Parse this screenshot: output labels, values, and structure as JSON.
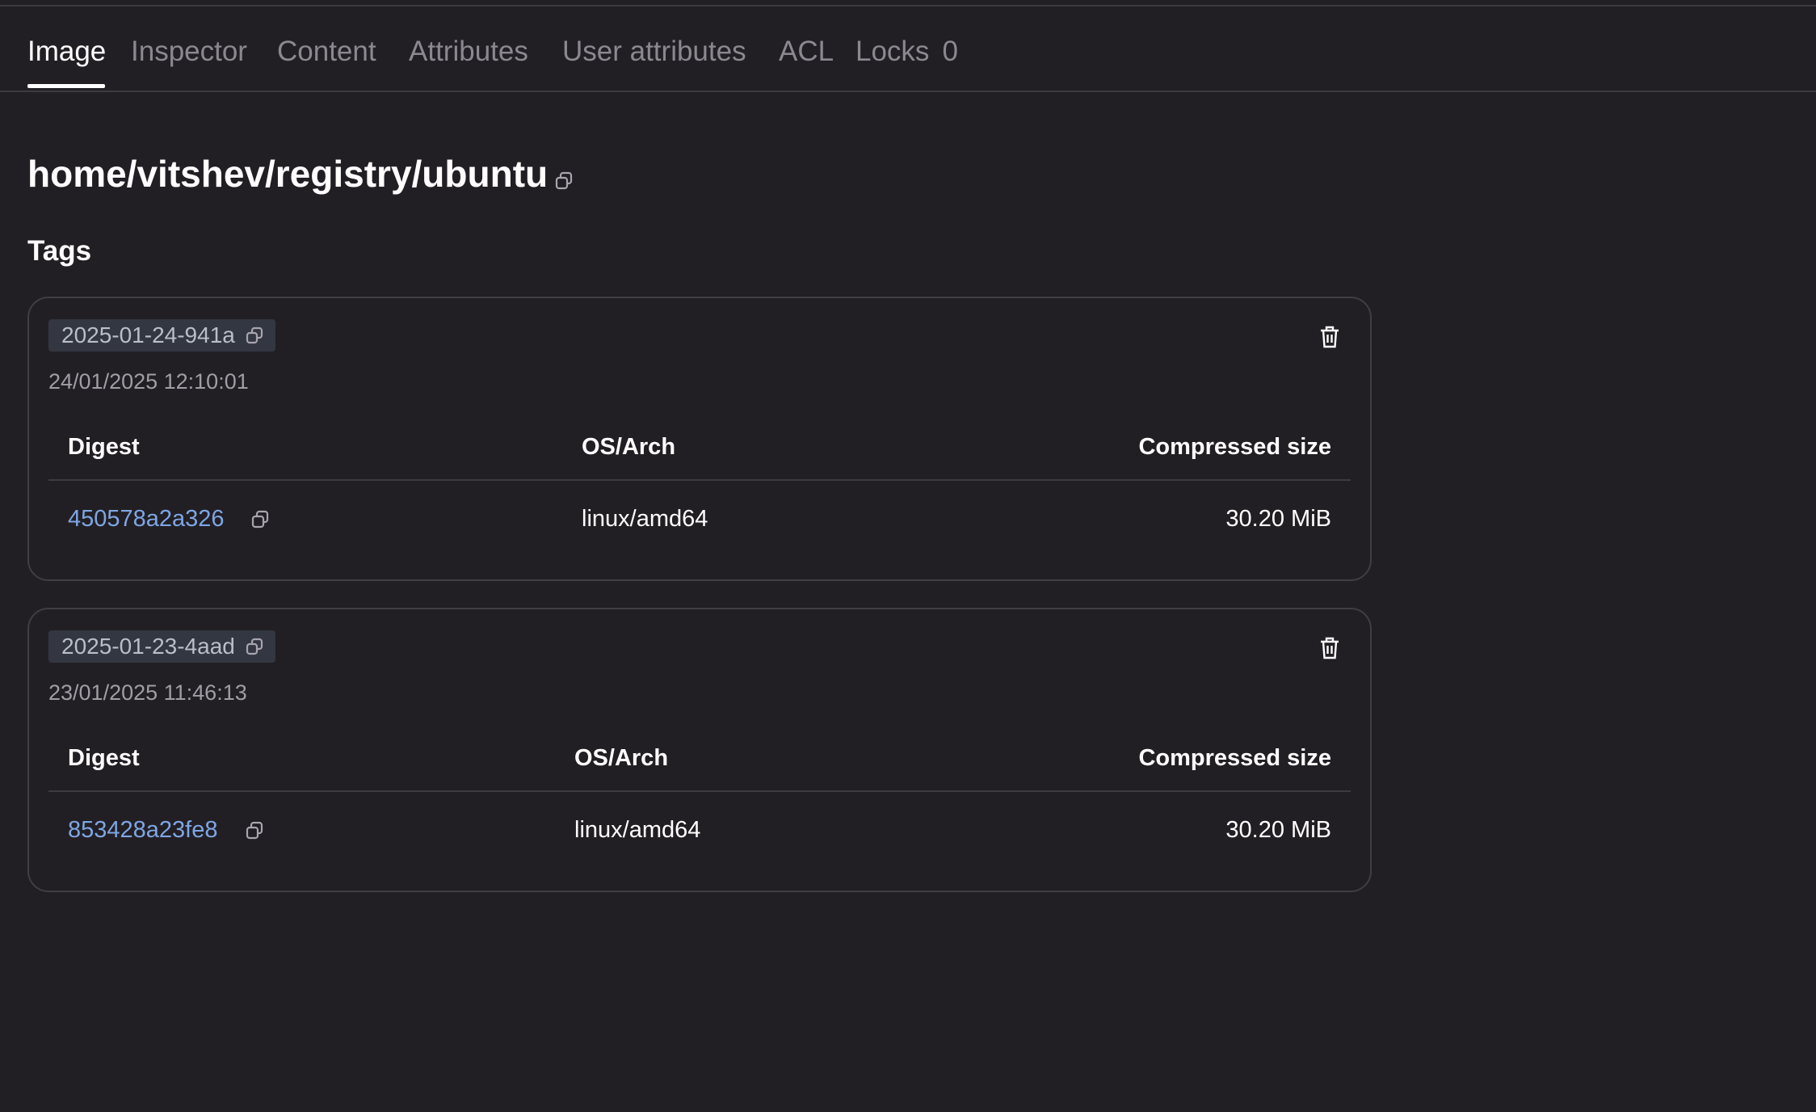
{
  "tabs": [
    {
      "label": "Image"
    },
    {
      "label": "Inspector"
    },
    {
      "label": "Content"
    },
    {
      "label": "Attributes"
    },
    {
      "label": "User attributes"
    },
    {
      "label": "ACL"
    },
    {
      "label": "Locks",
      "count": "0"
    }
  ],
  "active_tab": "Image",
  "page": {
    "title": "home/vitshev/registry/ubuntu",
    "section_title": "Tags"
  },
  "icons": {
    "copy": "copy-icon",
    "delete": "trash-icon"
  },
  "colors": {
    "background": "#221f24",
    "link": "#7ea6e3",
    "chip_bg": "#333741",
    "border": "#403d43"
  },
  "tags": [
    {
      "name": "2025-01-24-941a",
      "date": "24/01/2025 12:10:01",
      "columns": {
        "digest": "Digest",
        "os_arch": "OS/Arch",
        "size": "Compressed size"
      },
      "rows": [
        {
          "digest": "450578a2a326",
          "os_arch": "linux/amd64",
          "size": "30.20 MiB"
        }
      ]
    },
    {
      "name": "2025-01-23-4aad",
      "date": "23/01/2025 11:46:13",
      "columns": {
        "digest": "Digest",
        "os_arch": "OS/Arch",
        "size": "Compressed size"
      },
      "rows": [
        {
          "digest": "853428a23fe8",
          "os_arch": "linux/amd64",
          "size": "30.20 MiB"
        }
      ]
    }
  ]
}
